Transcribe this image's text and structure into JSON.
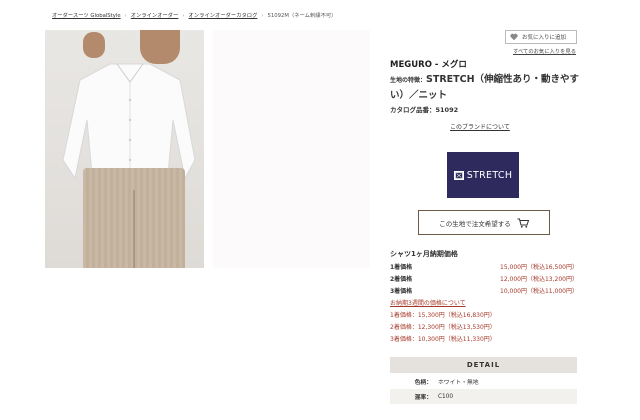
{
  "breadcrumb": {
    "items": [
      "オーダースーツ GlobalStyle",
      "オンラインオーダー",
      "オンラインオーダーカタログ"
    ],
    "current": "51092M（ネーム刺繍不可）"
  },
  "product_image": {
    "alt": ""
  },
  "favorites": {
    "add_label": "お気に入りに追加",
    "view_all": "すべてのお気に入りを見る"
  },
  "product": {
    "brand": "MEGURO - メグロ",
    "feature_label": "生地の特徴：",
    "feature_text": "STRETCH（伸縮性あり・動きやすい）／ニット",
    "catalog": "カタログ品番：51092",
    "about_brand": "このブランドについて"
  },
  "logo": {
    "text": "STRETCH",
    "bg": "#2e2a5e"
  },
  "order_button": {
    "label": "この生地で注文希望する"
  },
  "pricing": {
    "title": "シャツ1ヶ月納期価格",
    "rows": [
      {
        "label": "1着価格",
        "value": "15,000円（税込16,500円）"
      },
      {
        "label": "2着価格",
        "value": "12,000円（税込13,200円）"
      },
      {
        "label": "3着価格",
        "value": "10,000円（税込11,000円）"
      }
    ],
    "link_3week": "お納期3週間の価格について",
    "alt_rows": [
      "1着価格：15,300円（税込16,830円）",
      "2着価格：12,300円（税込13,530円）",
      "3着価格：10,300円（税込11,330円）"
    ]
  },
  "detail": {
    "title": "DETAIL",
    "rows": [
      {
        "key": "色柄：",
        "value": "ホワイト・無地"
      },
      {
        "key": "混率：",
        "value": "C100"
      }
    ]
  }
}
